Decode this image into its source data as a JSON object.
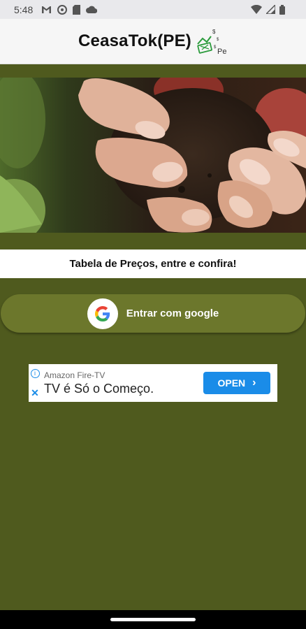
{
  "status_bar": {
    "time": "5:48",
    "left_icons": [
      "gmail-icon",
      "vpn-icon",
      "sim-card-icon",
      "cloud-icon"
    ],
    "right_icons": [
      "wifi-icon",
      "cell-signal-icon",
      "battery-icon"
    ]
  },
  "app_bar": {
    "title": "CeasaTok(PE)",
    "logo_text": "Pe"
  },
  "hero": {
    "image": "hands-holding-soil-and-potatoes"
  },
  "tagline": "Tabela de Preços, entre e confira!",
  "google_button": {
    "label": "Entrar com google",
    "icon": "google-g-icon"
  },
  "ad": {
    "advertiser": "Amazon Fire-TV",
    "headline": "TV é Só o Começo.",
    "cta": "OPEN"
  },
  "colors": {
    "background": "#4f5a1e",
    "button": "#6c772c",
    "ad_accent": "#1a8ce8"
  }
}
